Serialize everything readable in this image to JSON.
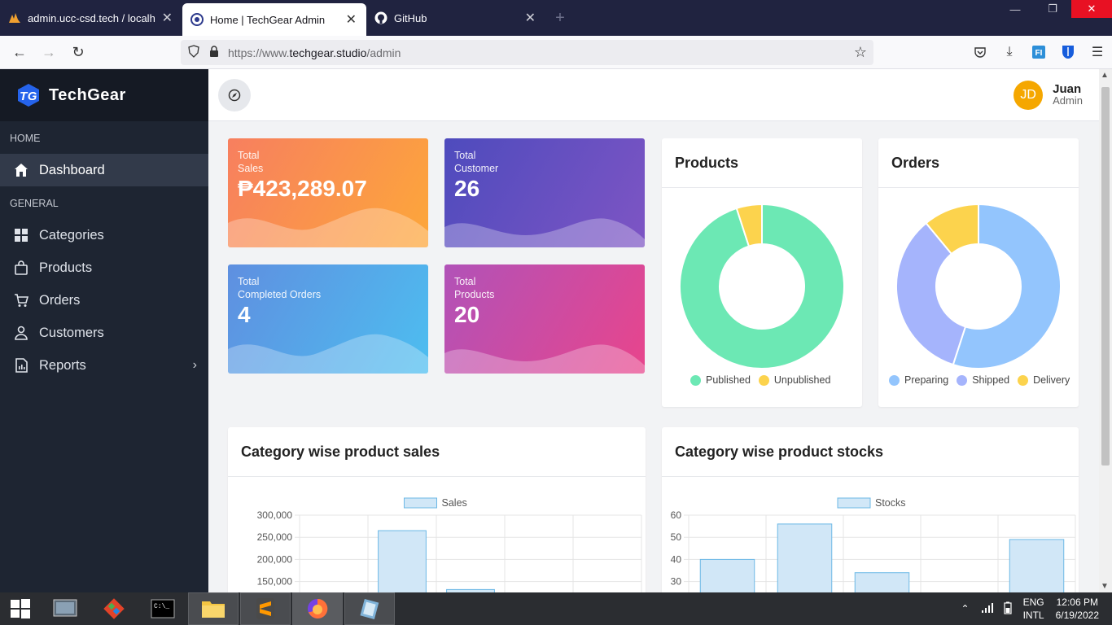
{
  "browser": {
    "tabs": [
      {
        "title": "admin.ucc-csd.tech / localhost",
        "active": false
      },
      {
        "title": "Home | TechGear Admin",
        "active": true
      },
      {
        "title": "GitHub",
        "active": false
      }
    ],
    "url_prefix": "https://www.",
    "url_host": "techgear.studio",
    "url_path": "/admin"
  },
  "brand": {
    "name": "TechGear"
  },
  "sidebar": {
    "sections": [
      {
        "title": "HOME",
        "items": [
          {
            "label": "Dashboard",
            "icon": "home-icon",
            "active": true
          }
        ]
      },
      {
        "title": "GENERAL",
        "items": [
          {
            "label": "Categories",
            "icon": "grid-icon"
          },
          {
            "label": "Products",
            "icon": "bag-icon"
          },
          {
            "label": "Orders",
            "icon": "cart-icon"
          },
          {
            "label": "Customers",
            "icon": "user-icon"
          },
          {
            "label": "Reports",
            "icon": "report-icon",
            "has_children": true
          }
        ]
      }
    ]
  },
  "user": {
    "initials": "JD",
    "name": "Juan",
    "role": "Admin"
  },
  "stats": [
    {
      "label_line1": "Total",
      "label_line2": "Sales",
      "value": "₱423,289.07",
      "color_from": "#f77f5f",
      "color_to": "#fda73a"
    },
    {
      "label_line1": "Total",
      "label_line2": "Customer",
      "value": "26",
      "color_from": "#4e4bbd",
      "color_to": "#7e55c4"
    },
    {
      "label_line1": "Total",
      "label_line2": "Completed Orders",
      "value": "4",
      "color_from": "#5f8fe0",
      "color_to": "#4dbef0"
    },
    {
      "label_line1": "Total",
      "label_line2": "Products",
      "value": "20",
      "color_from": "#b152b8",
      "color_to": "#e8458c"
    }
  ],
  "products_chart": {
    "title": "Products"
  },
  "orders_chart": {
    "title": "Orders"
  },
  "sales_chart": {
    "title": "Category wise product sales"
  },
  "stocks_chart": {
    "title": "Category wise product stocks"
  },
  "chart_data": [
    {
      "type": "pie",
      "title": "Products",
      "labels": [
        "Published",
        "Unpublished"
      ],
      "values": [
        19,
        1
      ],
      "colors": [
        "#6ce8b4",
        "#fcd34d"
      ],
      "donut": true,
      "legend": "bottom"
    },
    {
      "type": "pie",
      "title": "Orders",
      "labels": [
        "Preparing",
        "Shipped",
        "Delivery"
      ],
      "values": [
        55,
        34,
        11
      ],
      "colors": [
        "#93c5fd",
        "#a5b4fc",
        "#fcd34d"
      ],
      "donut": true,
      "legend": "bottom"
    },
    {
      "type": "bar",
      "title": "Category wise product sales",
      "series": [
        {
          "name": "Sales",
          "values": [
            0,
            265000,
            132000,
            0,
            0
          ]
        }
      ],
      "categories": [
        "",
        "",
        "",
        "",
        ""
      ],
      "yticks": [
        "300,000",
        "250,000",
        "200,000",
        "150,000"
      ],
      "ylim": [
        150000,
        300000
      ],
      "legend": "top",
      "color": "#d1e7f7",
      "edge": "#6cb8e6"
    },
    {
      "type": "bar",
      "title": "Category wise product stocks",
      "series": [
        {
          "name": "Stocks",
          "values": [
            40,
            56,
            34,
            0,
            49
          ]
        }
      ],
      "categories": [
        "",
        "",
        "",
        "",
        ""
      ],
      "yticks": [
        "60",
        "50",
        "40",
        "30"
      ],
      "ylim": [
        30,
        60
      ],
      "legend": "top",
      "color": "#d1e7f7",
      "edge": "#6cb8e6"
    }
  ],
  "taskbar": {
    "lang1": "ENG",
    "lang2": "INTL",
    "time": "12:06 PM",
    "date": "6/19/2022"
  }
}
